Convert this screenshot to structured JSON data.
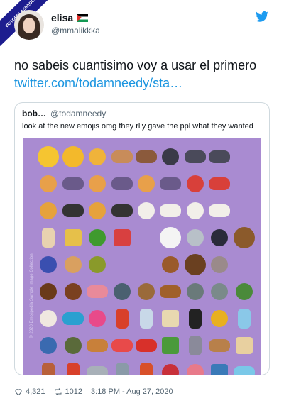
{
  "author": {
    "display_name": "elisa",
    "handle": "@mmalikkka",
    "watermark": "VISTOENLASREDES.COM"
  },
  "tweet": {
    "text": "no sabeis cuantisimo voy a usar el primero ",
    "link_text": "twitter.com/todamneedy/sta…"
  },
  "quoted": {
    "name": "bob…",
    "handle": "@todamneedy",
    "text": "look at the new emojis omg they rlly gave the ppl what they wanted",
    "image_caption": "© 2020 Emojipedia Sample Image Collection",
    "emojis": [
      {
        "name": "smiling-face-with-tear-icon",
        "c": "#f5c531",
        "k": "big"
      },
      {
        "name": "disguised-face-icon",
        "c": "#f3b92b",
        "k": "big"
      },
      {
        "name": "pinched-fingers-icon",
        "c": "#f0b33a",
        "k": ""
      },
      {
        "name": "pinched-fingers-tones-icon",
        "c": "#c88c5a",
        "k": "wide"
      },
      {
        "name": "pinched-fingers-tones-2-icon",
        "c": "#8b5a3c",
        "k": "wide"
      },
      {
        "name": "ninja-icon",
        "c": "#3a3a48",
        "k": ""
      },
      {
        "name": "ninja-tones-icon",
        "c": "#4a4a5a",
        "k": "wide"
      },
      {
        "name": "ninja-tones-2-icon",
        "c": "#4a4a5a",
        "k": "wide"
      },
      {
        "name": "blank",
        "c": "",
        "k": "none"
      },
      {
        "name": "person-feeding-baby-icon",
        "c": "#e8a04a",
        "k": ""
      },
      {
        "name": "person-feeding-tones-icon",
        "c": "#6a5a8a",
        "k": "wide"
      },
      {
        "name": "woman-feeding-baby-icon",
        "c": "#e8a04a",
        "k": ""
      },
      {
        "name": "woman-feeding-tones-icon",
        "c": "#6a5a8a",
        "k": "wide"
      },
      {
        "name": "man-feeding-baby-icon",
        "c": "#e8a04a",
        "k": ""
      },
      {
        "name": "man-feeding-tones-icon",
        "c": "#6a5a8a",
        "k": "wide"
      },
      {
        "name": "mx-claus-icon",
        "c": "#d8403a",
        "k": ""
      },
      {
        "name": "mx-claus-tones-icon",
        "c": "#d8403a",
        "k": "wide"
      },
      {
        "name": "blank",
        "c": "",
        "k": "none"
      },
      {
        "name": "person-in-tuxedo-icon",
        "c": "#e6a23c",
        "k": ""
      },
      {
        "name": "tuxedo-tones-icon",
        "c": "#333",
        "k": "wide"
      },
      {
        "name": "woman-in-tuxedo-icon",
        "c": "#e6a23c",
        "k": ""
      },
      {
        "name": "woman-tuxedo-tones-icon",
        "c": "#333",
        "k": "wide"
      },
      {
        "name": "woman-with-veil-icon",
        "c": "#f2efe9",
        "k": ""
      },
      {
        "name": "veil-tones-icon",
        "c": "#f2efe9",
        "k": "wide"
      },
      {
        "name": "man-with-veil-icon",
        "c": "#f2efe9",
        "k": ""
      },
      {
        "name": "man-veil-tones-icon",
        "c": "#f2efe9",
        "k": "wide"
      },
      {
        "name": "blank",
        "c": "",
        "k": "none"
      },
      {
        "name": "bubble-tea-icon",
        "c": "#e8d2b0",
        "k": "tall"
      },
      {
        "name": "tamale-icon",
        "c": "#e6c04a",
        "k": "sq"
      },
      {
        "name": "bell-pepper-icon",
        "c": "#3f9a2e",
        "k": ""
      },
      {
        "name": "fondue-icon",
        "c": "#d84040",
        "k": "sq"
      },
      {
        "name": "blank",
        "c": "",
        "k": "none"
      },
      {
        "name": "polar-bear-icon",
        "c": "#f4f4f4",
        "k": "big"
      },
      {
        "name": "seal-icon",
        "c": "#b8c0c8",
        "k": ""
      },
      {
        "name": "black-cat-icon",
        "c": "#2a2a3a",
        "k": ""
      },
      {
        "name": "mammoth-icon",
        "c": "#8b5a2b",
        "k": "big"
      },
      {
        "name": "blueberries-icon",
        "c": "#3a4fb0",
        "k": ""
      },
      {
        "name": "flatbread-icon",
        "c": "#d9a060",
        "k": ""
      },
      {
        "name": "olive-icon",
        "c": "#8a9a2a",
        "k": ""
      },
      {
        "name": "blank",
        "c": "",
        "k": "none"
      },
      {
        "name": "blank",
        "c": "",
        "k": "none"
      },
      {
        "name": "beaver-icon",
        "c": "#9a5a2a",
        "k": ""
      },
      {
        "name": "bison-icon",
        "c": "#6a4020",
        "k": "big"
      },
      {
        "name": "dodo-icon",
        "c": "#9a8a8a",
        "k": ""
      },
      {
        "name": "blank",
        "c": "",
        "k": "none"
      },
      {
        "name": "beetle-icon",
        "c": "#6a3a1a",
        "k": ""
      },
      {
        "name": "cockroach-icon",
        "c": "#7a4020",
        "k": ""
      },
      {
        "name": "worm-icon",
        "c": "#e88a9a",
        "k": "wide"
      },
      {
        "name": "fly-icon",
        "c": "#4a6070",
        "k": ""
      },
      {
        "name": "hut-icon",
        "c": "#9a6a3a",
        "k": ""
      },
      {
        "name": "wood-icon",
        "c": "#a0602a",
        "k": "wide"
      },
      {
        "name": "rock-icon",
        "c": "#6a7a7a",
        "k": ""
      },
      {
        "name": "headstone-icon",
        "c": "#7a8a8a",
        "k": ""
      },
      {
        "name": "potted-plant-icon",
        "c": "#4a8a3a",
        "k": ""
      },
      {
        "name": "roller-skate-icon",
        "c": "#f0e8e0",
        "k": ""
      },
      {
        "name": "thong-sandal-icon",
        "c": "#2aa0d0",
        "k": "wide"
      },
      {
        "name": "pinata-icon",
        "c": "#e84a8a",
        "k": ""
      },
      {
        "name": "nesting-dolls-icon",
        "c": "#d8402a",
        "k": "tall"
      },
      {
        "name": "mirror-icon",
        "c": "#c8d8e8",
        "k": "tall"
      },
      {
        "name": "window-icon",
        "c": "#e8d8b0",
        "k": "sq"
      },
      {
        "name": "magic-wand-icon",
        "c": "#222",
        "k": "tall"
      },
      {
        "name": "coin-icon",
        "c": "#e8b020",
        "k": ""
      },
      {
        "name": "feather-icon",
        "c": "#8ac8e8",
        "k": "tall"
      },
      {
        "name": "knot-icon",
        "c": "#3a6ab0",
        "k": ""
      },
      {
        "name": "military-helmet-icon",
        "c": "#5a6a3a",
        "k": ""
      },
      {
        "name": "boomerang-icon",
        "c": "#c8803a",
        "k": "wide"
      },
      {
        "name": "toothbrush-icon",
        "c": "#e84a4a",
        "k": "wide"
      },
      {
        "name": "pickup-truck-icon",
        "c": "#d8302a",
        "k": "wide"
      },
      {
        "name": "bucket-icon",
        "c": "#4a9a3a",
        "k": "sq"
      },
      {
        "name": "hook-icon",
        "c": "#8a8a9a",
        "k": "tall"
      },
      {
        "name": "mouse-trap-icon",
        "c": "#b8804a",
        "k": "wide"
      },
      {
        "name": "placard-icon",
        "c": "#e8d0a0",
        "k": "sq"
      },
      {
        "name": "ladder-icon",
        "c": "#b8603a",
        "k": "tall"
      },
      {
        "name": "screwdriver-icon",
        "c": "#d8402a",
        "k": "tall"
      },
      {
        "name": "carpentry-saw-icon",
        "c": "#a8b0b8",
        "k": "wide"
      },
      {
        "name": "hook-2-icon",
        "c": "#8a9aa8",
        "k": "tall"
      },
      {
        "name": "plunger-icon",
        "c": "#d8502a",
        "k": "tall"
      },
      {
        "name": "anatomical-heart-icon",
        "c": "#c8303a",
        "k": ""
      },
      {
        "name": "lungs-icon",
        "c": "#e87a8a",
        "k": ""
      },
      {
        "name": "elevator-icon",
        "c": "#3a7ab8",
        "k": "sq"
      },
      {
        "name": "transgender-flag-icon",
        "c": "#7ac8e8",
        "k": "wide"
      }
    ]
  },
  "stats": {
    "likes": "4,321",
    "retweets": "1012",
    "timestamp": "3:18 PM - Aug 27, 2020"
  }
}
